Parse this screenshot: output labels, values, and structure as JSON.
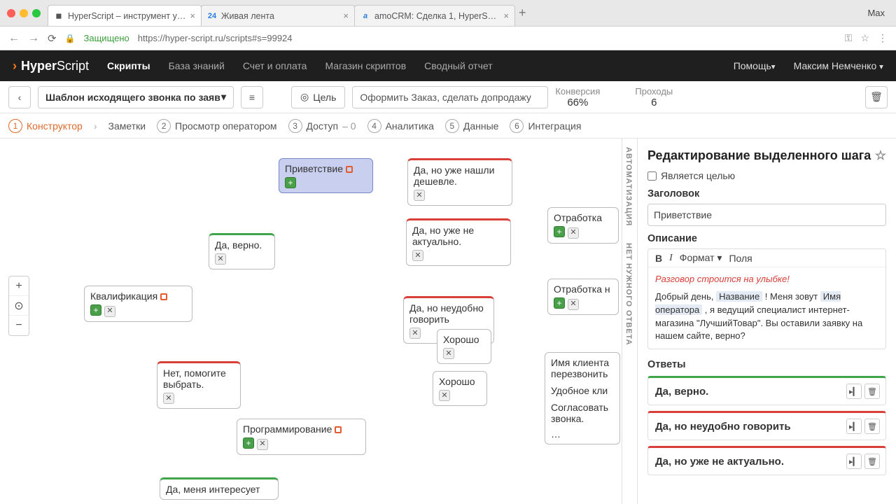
{
  "chrome": {
    "tabs": [
      {
        "favicon": "H",
        "title": "HyperScript – инструмент у…"
      },
      {
        "favicon": "24",
        "title": "Живая лента"
      },
      {
        "favicon": "a",
        "title": "amoCRM: Сделка 1, HyperSc…"
      }
    ],
    "user": "Max",
    "secure": "Защищено",
    "url": "https://hyper-script.ru/scripts#s=99924"
  },
  "header": {
    "brand_bold": "Hyper",
    "brand_light": "Script",
    "nav": [
      "Скрипты",
      "База знаний",
      "Счет и оплата",
      "Магазин скриптов",
      "Сводный отчет"
    ],
    "help": "Помощь",
    "user": "Максим Немченко"
  },
  "toolbar": {
    "template": "Шаблон исходящего звонка по заяв",
    "goal_label": "Цель",
    "goal_text": "Оформить Заказ, сделать допродажу",
    "stat1_label": "Конверсия",
    "stat1_val": "66%",
    "stat2_label": "Проходы",
    "stat2_val": "6"
  },
  "subtabs": {
    "s1": "Конструктор",
    "s1b": "Заметки",
    "s2": "Просмотр оператором",
    "s3": "Доступ",
    "s3v": "– 0",
    "s4": "Аналитика",
    "s5": "Данные",
    "s6": "Интеграция"
  },
  "nodes": {
    "n1": "Приветствие",
    "n2": "Да, но уже нашли дешевле.",
    "n3": "Да, верно.",
    "n4": "Да, но уже не актуально.",
    "n5": "Квалификация",
    "n6": "Да, но неудобно говорить",
    "n7": "Хорошо",
    "n8": "Хорошо",
    "n9": "Нет, помогите выбрать.",
    "n10": "Программирование",
    "n11": "Да, меня интересует",
    "n12": "Отработка",
    "n13": "Отработка н",
    "clip1": "Имя клиента",
    "clip1b": "перезвонить",
    "clip2": "Удобное кли",
    "clip3": "Согласовать",
    "clip3b": "звонка.",
    "clip4": "…"
  },
  "vtabs": {
    "a": "АВТОМАТИЗАЦИЯ",
    "b": "НЕТ НУЖНОГО ОТВЕТА"
  },
  "side": {
    "title": "Редактирование выделенного шага",
    "is_goal": "Является целью",
    "head_label": "Заголовок",
    "head_val": "Приветствие",
    "desc_label": "Описание",
    "rtb_format": "Формат",
    "rtb_fields": "Поля",
    "warn": "Разговор строится на улыбке!",
    "body_p1": "Добрый день, ",
    "tag1": "Название",
    "body_p2": " ! Меня зовут ",
    "tag2": "Имя оператора",
    "body_p3": " , я ведущий специалист интернет-магазина \"ЛучшийТовар\". Вы оставили заявку на нашем сайте, верно?",
    "answers_label": "Ответы",
    "a1": "Да, верно.",
    "a2": "Да, но неудобно говорить",
    "a3": "Да, но уже не актуально."
  }
}
